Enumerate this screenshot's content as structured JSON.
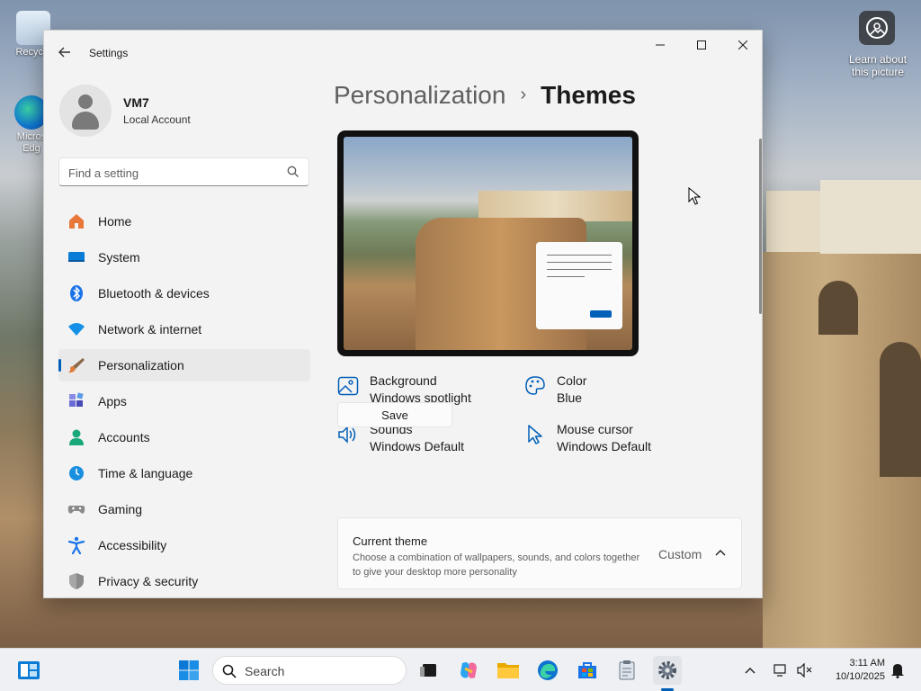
{
  "desktop": {
    "icons": [
      {
        "label": "Recycle",
        "icon": "recycle-bin-icon"
      },
      {
        "label": "Micros Edg",
        "icon": "edge-icon"
      }
    ],
    "learn_label": "Learn about this picture"
  },
  "window": {
    "title": "Settings",
    "controls": {
      "minimize": "—",
      "maximize": "☐",
      "close": "✕"
    }
  },
  "profile": {
    "name": "VM7",
    "type": "Local Account"
  },
  "search": {
    "placeholder": "Find a setting"
  },
  "nav": {
    "items": [
      {
        "label": "Home",
        "icon": "home-icon",
        "color": "#e8773a"
      },
      {
        "label": "System",
        "icon": "system-icon",
        "color": "#0a7cd6"
      },
      {
        "label": "Bluetooth & devices",
        "icon": "bluetooth-icon",
        "color": "#1a73e8"
      },
      {
        "label": "Network & internet",
        "icon": "wifi-icon",
        "color": "#1491e6"
      },
      {
        "label": "Personalization",
        "icon": "brush-icon",
        "color": "#e07b39"
      },
      {
        "label": "Apps",
        "icon": "apps-icon",
        "color": "#6b6bd6"
      },
      {
        "label": "Accounts",
        "icon": "accounts-icon",
        "color": "#18a87a"
      },
      {
        "label": "Time & language",
        "icon": "globe-icon",
        "color": "#1a8fe0"
      },
      {
        "label": "Gaming",
        "icon": "gamepad-icon",
        "color": "#8a8a8a"
      },
      {
        "label": "Accessibility",
        "icon": "accessibility-icon",
        "color": "#1a73e8"
      },
      {
        "label": "Privacy & security",
        "icon": "shield-icon",
        "color": "#8a8a8a"
      }
    ],
    "active_index": 4
  },
  "breadcrumb": {
    "parent": "Personalization",
    "separator": "›",
    "current": "Themes"
  },
  "properties": {
    "background": {
      "title": "Background",
      "value": "Windows spotlight"
    },
    "color": {
      "title": "Color",
      "value": "Blue"
    },
    "sounds": {
      "title": "Sounds",
      "value": "Windows Default"
    },
    "cursor": {
      "title": "Mouse cursor",
      "value": "Windows Default"
    }
  },
  "save_button": "Save",
  "current_theme": {
    "title": "Current theme",
    "description": "Choose a combination of wallpapers, sounds, and colors together to give your desktop more personality",
    "value": "Custom"
  },
  "taskbar": {
    "search_label": "Search",
    "time": "3:11 AM",
    "date": "10/10/2025"
  },
  "colors": {
    "accent": "#005fb8"
  }
}
